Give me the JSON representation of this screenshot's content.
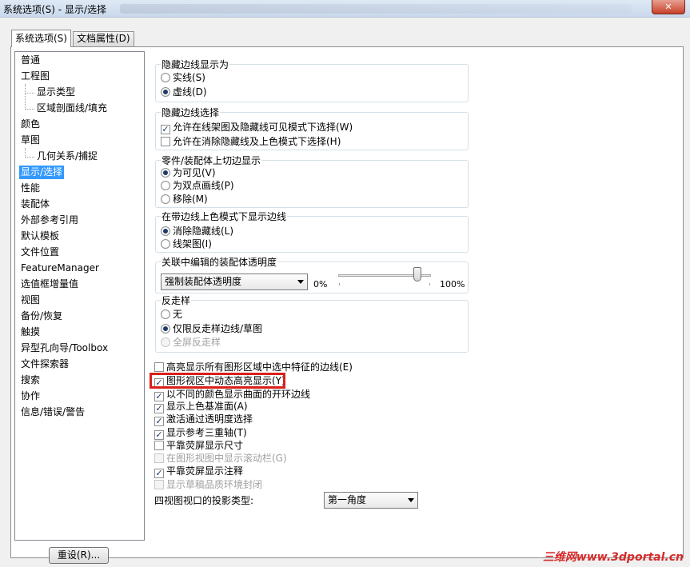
{
  "window": {
    "title": "系统选项(S) - 显示/选择",
    "close_symbol": "✕"
  },
  "tabs": [
    {
      "label": "系统选项(S)",
      "active": true
    },
    {
      "label": "文档属性(D)",
      "active": false
    }
  ],
  "tree": {
    "items": [
      {
        "label": "普通",
        "level": 0
      },
      {
        "label": "工程图",
        "level": 0
      },
      {
        "label": "显示类型",
        "level": 1
      },
      {
        "label": "区域剖面线/填充",
        "level": 1
      },
      {
        "label": "颜色",
        "level": 0
      },
      {
        "label": "草图",
        "level": 0
      },
      {
        "label": "几何关系/捕捉",
        "level": 1
      },
      {
        "label": "显示/选择",
        "level": 0,
        "selected": true
      },
      {
        "label": "性能",
        "level": 0
      },
      {
        "label": "装配体",
        "level": 0
      },
      {
        "label": "外部参考引用",
        "level": 0
      },
      {
        "label": "默认模板",
        "level": 0
      },
      {
        "label": "文件位置",
        "level": 0
      },
      {
        "label": "FeatureManager",
        "level": 0
      },
      {
        "label": "选值框增量值",
        "level": 0
      },
      {
        "label": "视图",
        "level": 0
      },
      {
        "label": "备份/恢复",
        "level": 0
      },
      {
        "label": "触摸",
        "level": 0
      },
      {
        "label": "异型孔向导/Toolbox",
        "level": 0
      },
      {
        "label": "文件探索器",
        "level": 0
      },
      {
        "label": "搜索",
        "level": 0
      },
      {
        "label": "协作",
        "level": 0
      },
      {
        "label": "信息/错误/警告",
        "level": 0
      }
    ]
  },
  "groups": {
    "hidden_edge_display": {
      "title": "隐藏边线显示为",
      "options": [
        {
          "label": "实线(S)",
          "checked": false
        },
        {
          "label": "虚线(D)",
          "checked": true
        }
      ]
    },
    "hidden_edge_select": {
      "title": "隐藏边线选择",
      "options": [
        {
          "label": "允许在线架图及隐藏线可见模式下选择(W)",
          "checked": true
        },
        {
          "label": "允许在消除隐藏线及上色模式下选择(H)",
          "checked": false
        }
      ]
    },
    "tangent_edges": {
      "title": "零件/装配体上切边显示",
      "options": [
        {
          "label": "为可见(V)",
          "checked": true
        },
        {
          "label": "为双点画线(P)",
          "checked": false
        },
        {
          "label": "移除(M)",
          "checked": false
        }
      ]
    },
    "shaded_edges": {
      "title": "在带边线上色模式下显示边线",
      "options": [
        {
          "label": "消除隐藏线(L)",
          "checked": true
        },
        {
          "label": "线架图(I)",
          "checked": false
        }
      ]
    },
    "assembly_transparency": {
      "title": "关联中编辑的装配体透明度",
      "select_value": "强制装配体透明度",
      "slider_min_label": "0%",
      "slider_max_label": "100%",
      "slider_value": 0.85
    },
    "antialiasing": {
      "title": "反走样",
      "options": [
        {
          "label": "无",
          "checked": false,
          "disabled": false
        },
        {
          "label": "仅限反走样边线/草图",
          "checked": true,
          "disabled": false
        },
        {
          "label": "全屏反走样",
          "checked": false,
          "disabled": true
        }
      ]
    }
  },
  "checkboxes": [
    {
      "label": "高亮显示所有图形区域中选中特征的边线(E)",
      "checked": false,
      "disabled": false
    },
    {
      "label": "图形视区中动态高亮显示(Y)",
      "checked": true,
      "disabled": false
    },
    {
      "label": "以不同的颜色显示曲面的开环边线",
      "checked": true,
      "disabled": false
    },
    {
      "label": "显示上色基准面(A)",
      "checked": true,
      "disabled": false
    },
    {
      "label": "激活通过透明度选择",
      "checked": true,
      "disabled": false
    },
    {
      "label": "显示参考三重轴(T)",
      "checked": true,
      "disabled": false
    },
    {
      "label": "平靠荧屏显示尺寸",
      "checked": false,
      "disabled": false
    },
    {
      "label": "在图形视图中显示滚动栏(G)",
      "checked": false,
      "disabled": true
    },
    {
      "label": "平靠荧屏显示注释",
      "checked": true,
      "disabled": false
    },
    {
      "label": "显示草稿品质环境封闭",
      "checked": false,
      "disabled": true
    }
  ],
  "projection": {
    "label": "四视图视口的投影类型:",
    "value": "第一角度"
  },
  "reset_button": "重设(R)...",
  "watermark": "三维网www.3dportal.cn",
  "colors": {
    "selection": "#3399ff",
    "highlight_border": "#d9201a",
    "watermark": "#d72a2a"
  }
}
